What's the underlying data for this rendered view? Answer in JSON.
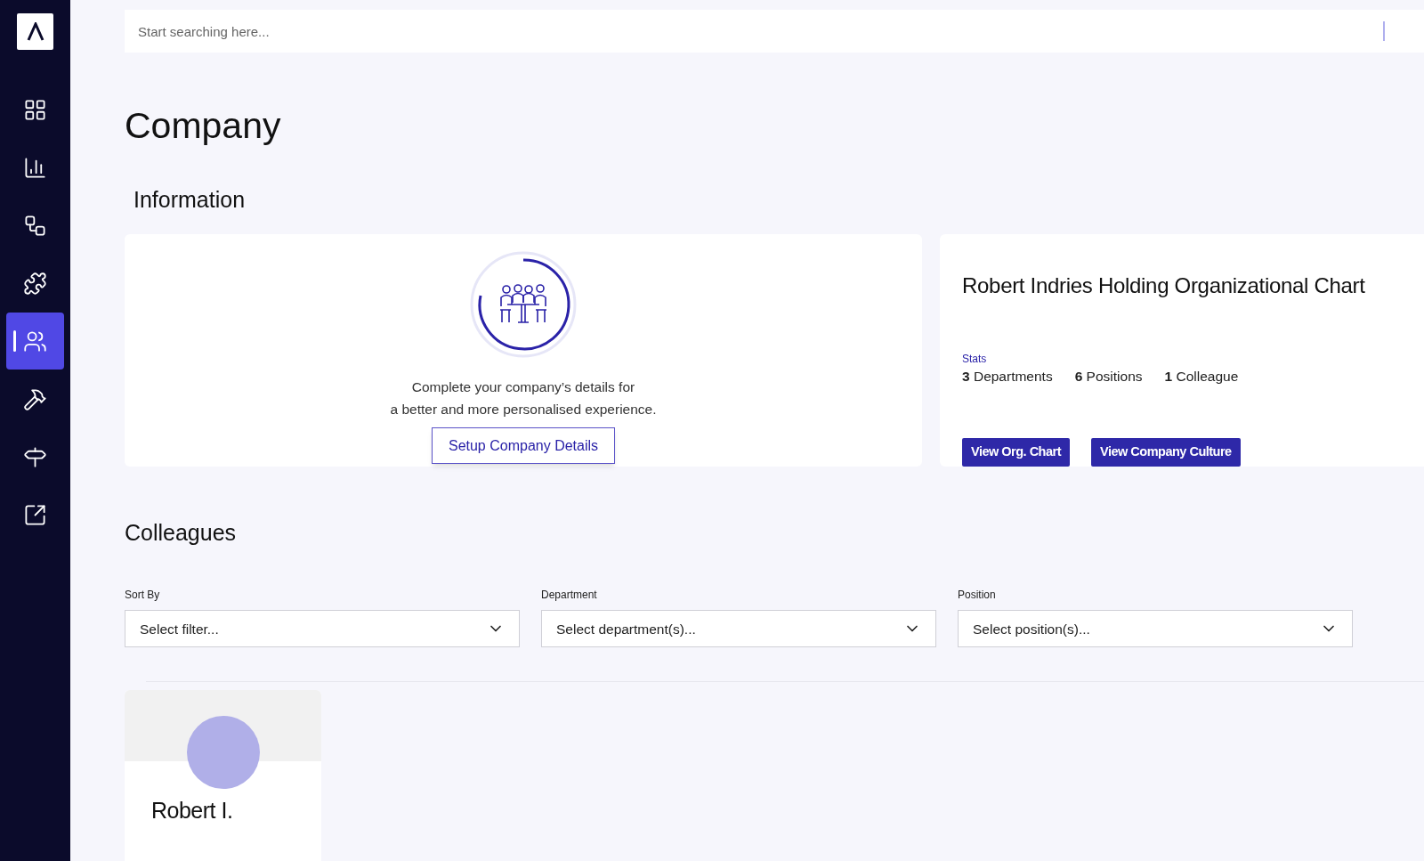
{
  "sidebar": {
    "items": [
      {
        "selected": false
      },
      {
        "selected": false
      },
      {
        "selected": false
      },
      {
        "selected": false
      },
      {
        "selected": true
      },
      {
        "selected": false
      },
      {
        "selected": false
      },
      {
        "selected": false
      }
    ]
  },
  "search": {
    "placeholder": "Start searching here..."
  },
  "page_title": "Company",
  "information": {
    "heading": "Information",
    "setup_card": {
      "message_lines": [
        "Complete your company’s details for",
        "a better and more personalised experience."
      ],
      "button": "Setup Company Details"
    },
    "org_card": {
      "title": "Robert Indries Holding Organizational Chart",
      "stats_label": "Stats",
      "stats": [
        {
          "count": "3",
          "label": "Departments"
        },
        {
          "count": "6",
          "label": "Positions"
        },
        {
          "count": "1",
          "label": "Colleague"
        }
      ],
      "buttons": [
        "View Org. Chart",
        "View Company Culture"
      ]
    }
  },
  "colleagues": {
    "heading": "Colleagues",
    "filters": [
      {
        "label": "Sort By",
        "placeholder": "Select filter..."
      },
      {
        "label": "Department",
        "placeholder": "Select department(s)..."
      },
      {
        "label": "Position",
        "placeholder": "Select position(s)..."
      }
    ],
    "cards": [
      {
        "name": "Robert I."
      }
    ]
  }
}
